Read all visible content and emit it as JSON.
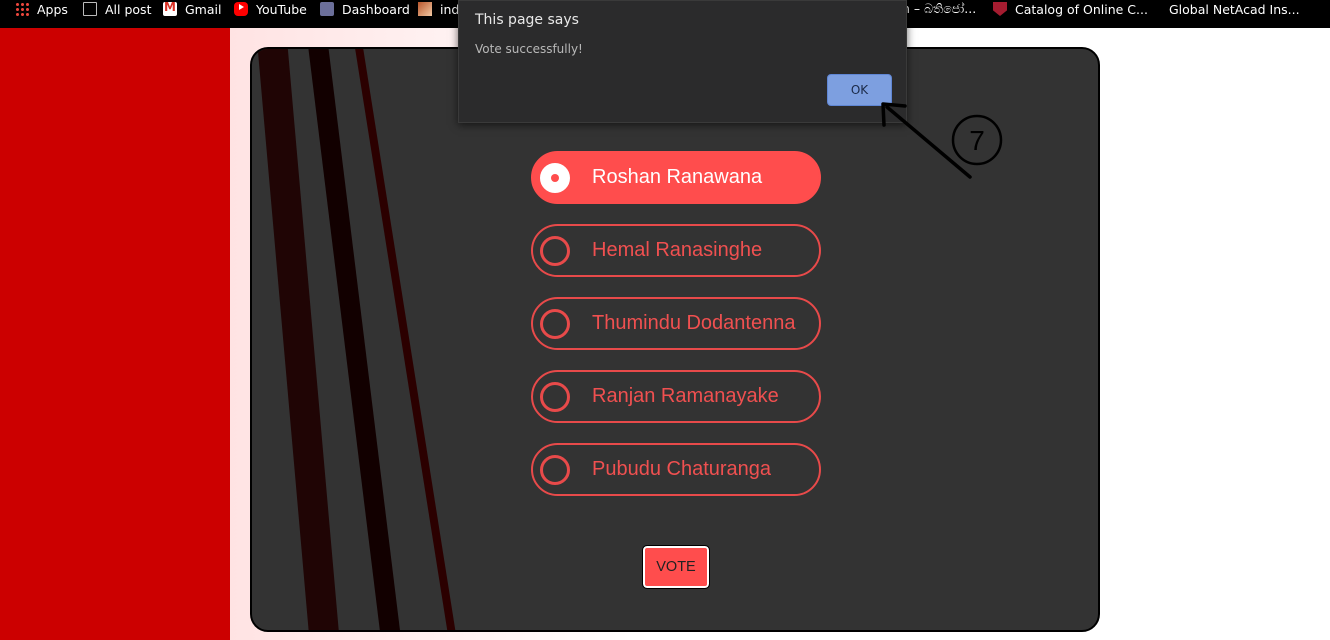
{
  "bookmarks": [
    {
      "label": "Apps",
      "icon": "apps-icon"
    },
    {
      "label": "All post",
      "icon": "monitor-icon"
    },
    {
      "label": "Gmail",
      "icon": "gmail-icon"
    },
    {
      "label": "YouTube",
      "icon": "youtube-icon"
    },
    {
      "label": "Dashboard",
      "icon": "dashboard-icon"
    },
    {
      "label": "ind",
      "icon": "site-icon"
    },
    {
      "label": "n – බතිජෝ...",
      "icon": ""
    },
    {
      "label": "Catalog of Online C...",
      "icon": "harvard-icon"
    },
    {
      "label": "Global NetAcad Ins...",
      "icon": ""
    }
  ],
  "dialog": {
    "title": "This page says",
    "message": "Vote successfully!",
    "ok_label": "OK"
  },
  "candidates": [
    {
      "name": "Roshan Ranawana",
      "selected": true
    },
    {
      "name": "Hemal Ranasinghe",
      "selected": false
    },
    {
      "name": "Thumindu Dodantenna",
      "selected": false
    },
    {
      "name": "Ranjan Ramanayake",
      "selected": false
    },
    {
      "name": "Pubudu Chaturanga",
      "selected": false
    }
  ],
  "vote_button": {
    "label": "VOTE"
  },
  "annotation": {
    "step_number": "7"
  },
  "colors": {
    "accent": "#ff4d4d",
    "card_bg": "#333333",
    "dialog_bg": "#2b2b2c",
    "ok_button": "#7d9fe0"
  }
}
